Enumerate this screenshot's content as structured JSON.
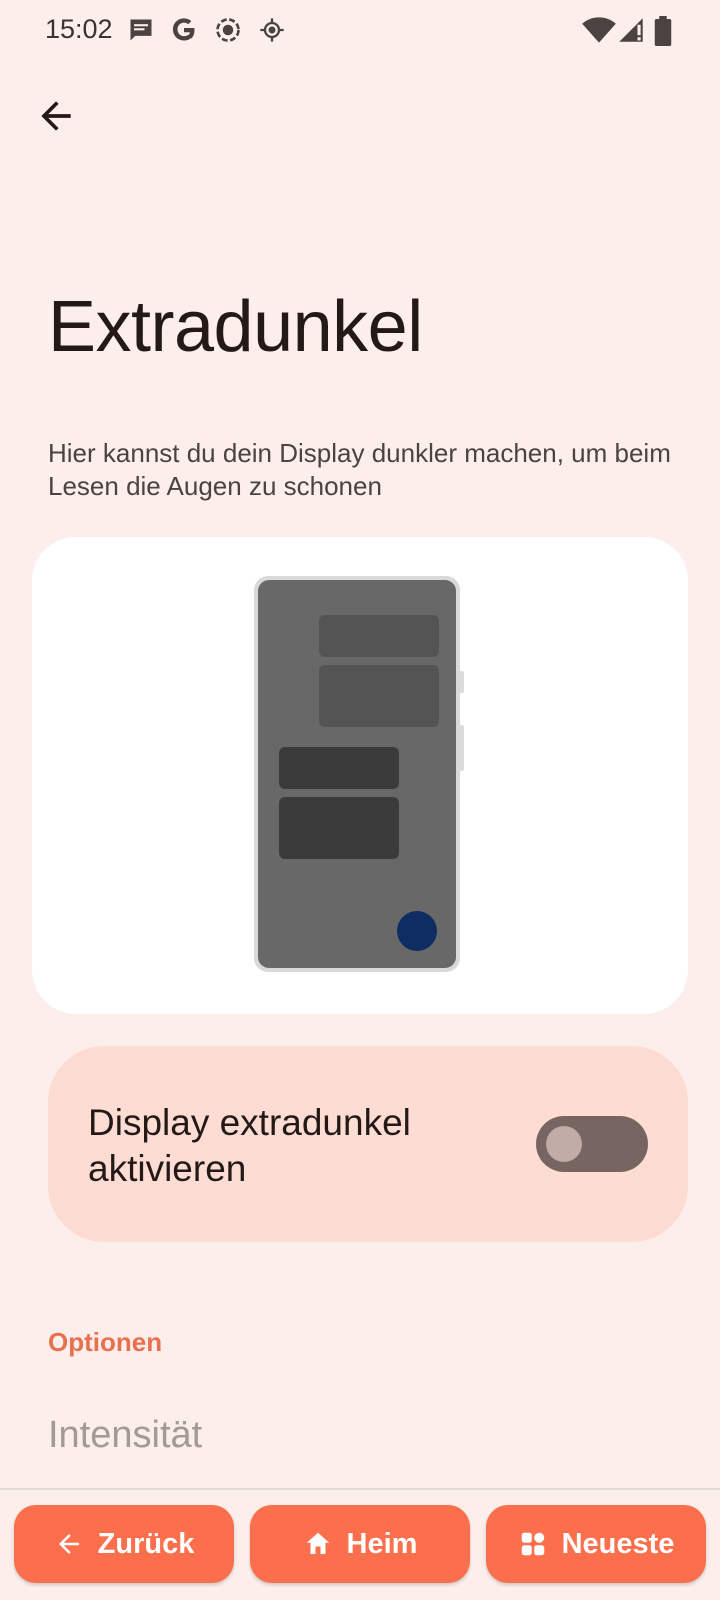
{
  "status": {
    "time": "15:02"
  },
  "header": {
    "back_label": "Zurück"
  },
  "page": {
    "title": "Extradunkel",
    "description": "Hier kannst du dein Display dunkler machen, um beim Lesen die Augen zu schonen"
  },
  "toggle": {
    "label": "Display extradunkel aktivieren",
    "enabled": false
  },
  "options": {
    "header": "Optionen",
    "intensity_label": "Intensität"
  },
  "nav": {
    "back": "Zurück",
    "home": "Heim",
    "recents": "Neueste"
  },
  "colors": {
    "background": "#fcefeb",
    "accent": "#fc6f4c",
    "toggle_card": "#fddcd4",
    "section_header": "#e8704e"
  }
}
